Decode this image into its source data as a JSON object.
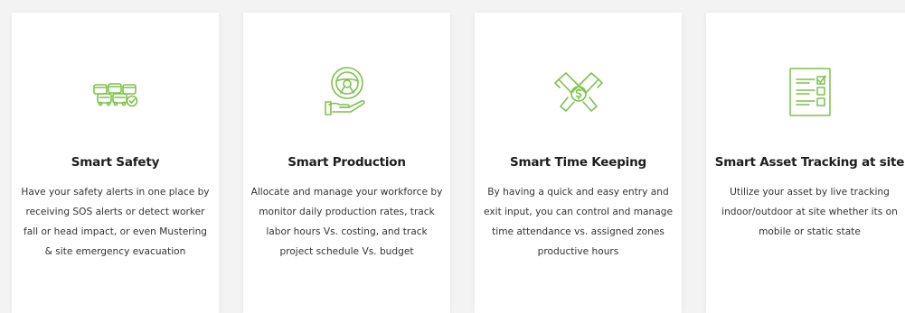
{
  "accent_color": "#7dc24b",
  "cards": [
    {
      "icon": "vehicles-fleet-icon",
      "title": "Smart Safety",
      "description": "Have your safety alerts in one place by receiving SOS alerts or detect worker fall or head impact, or even Mustering & site emergency evacuation"
    },
    {
      "icon": "steering-wheel-hand-icon",
      "title": "Smart Production",
      "description": "Allocate and manage your workforce by monitor daily production rates, track labor hours Vs. costing, and track project schedule Vs. budget"
    },
    {
      "icon": "handshake-dollar-icon",
      "title": "Smart Time Keeping",
      "description": "By having a quick and easy entry and exit input, you can control and manage time attendance vs. assigned zones productive hours"
    },
    {
      "icon": "checklist-icon",
      "title": "Smart Asset Tracking at site",
      "description": "Utilize your asset by live tracking indoor/outdoor at site whether its on mobile or static state"
    }
  ]
}
